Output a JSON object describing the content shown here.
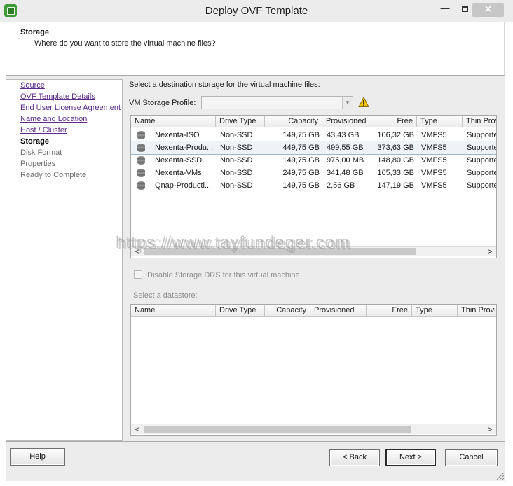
{
  "window": {
    "title": "Deploy OVF Template",
    "minimize": "—",
    "close": "✕"
  },
  "header": {
    "title": "Storage",
    "subtitle": "Where do you want to store the virtual machine files?"
  },
  "steps": [
    {
      "label": "Source",
      "state": "done"
    },
    {
      "label": "OVF Template Details",
      "state": "done"
    },
    {
      "label": "End User License Agreement",
      "state": "done"
    },
    {
      "label": "Name and Location",
      "state": "done"
    },
    {
      "label": "Host / Cluster",
      "state": "done"
    },
    {
      "label": "Storage",
      "state": "current"
    },
    {
      "label": "Disk Format",
      "state": "future"
    },
    {
      "label": "Properties",
      "state": "future"
    },
    {
      "label": "Ready to Complete",
      "state": "future"
    }
  ],
  "main": {
    "instruction": "Select a destination storage for the virtual machine files:",
    "profile_label": "VM Storage Profile:",
    "profile_value": "",
    "profile_arrow": "▼",
    "storage_table": {
      "columns": [
        "Name",
        "Drive Type",
        "Capacity",
        "Provisioned",
        "Free",
        "Type",
        "Thin Prov"
      ],
      "rows": [
        [
          "Nexenta-ISO",
          "Non-SSD",
          "149,75 GB",
          "43,43 GB",
          "106,32 GB",
          "VMFS5",
          "Supported"
        ],
        [
          "Nexenta-Produ...",
          "Non-SSD",
          "449,75 GB",
          "499,55 GB",
          "373,63 GB",
          "VMFS5",
          "Supported"
        ],
        [
          "Nexenta-SSD",
          "Non-SSD",
          "149,75 GB",
          "975,00 MB",
          "148,80 GB",
          "VMFS5",
          "Supported"
        ],
        [
          "Nexenta-VMs",
          "Non-SSD",
          "249,75 GB",
          "341,48 GB",
          "165,33 GB",
          "VMFS5",
          "Supported"
        ],
        [
          "Qnap-Producti...",
          "Non-SSD",
          "149,75 GB",
          "2,56 GB",
          "147,19 GB",
          "VMFS5",
          "Supported"
        ]
      ],
      "selected_row": 1
    },
    "disable_drs_label": "Disable Storage DRS for this virtual machine",
    "select_datastore_label": "Select a datastore:",
    "datastore_table": {
      "columns": [
        "Name",
        "Drive Type",
        "Capacity",
        "Provisioned",
        "Free",
        "Type",
        "Thin Provi"
      ]
    },
    "scroll_left": "<",
    "scroll_right": ">"
  },
  "buttons": {
    "help": "Help",
    "back": "< Back",
    "next": "Next >",
    "cancel": "Cancel"
  },
  "watermark": "https://www.tayfundeger.com",
  "colors": {
    "link": "#5c2a8a",
    "warning": "#f2c200",
    "selection": "#eef3f8"
  }
}
